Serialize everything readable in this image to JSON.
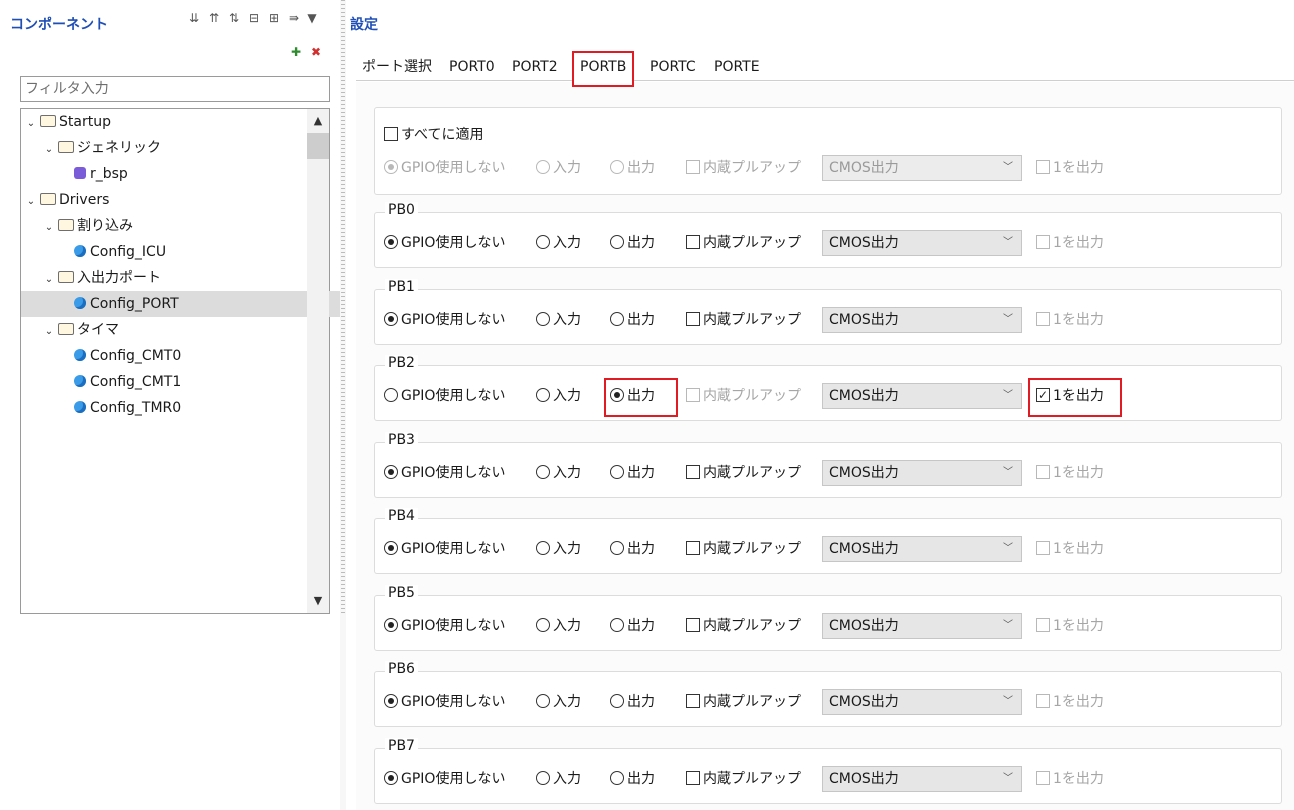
{
  "left": {
    "title": "コンポーネント",
    "filter_placeholder": "フィルタ入力",
    "tree": [
      {
        "label": "Startup",
        "level": 0,
        "kind": "folder"
      },
      {
        "label": "ジェネリック",
        "level": 1,
        "kind": "folder"
      },
      {
        "label": "r_bsp",
        "level": 2,
        "kind": "bsp"
      },
      {
        "label": "Drivers",
        "level": 0,
        "kind": "folder"
      },
      {
        "label": "割り込み",
        "level": 1,
        "kind": "folder"
      },
      {
        "label": "Config_ICU",
        "level": 2,
        "kind": "config"
      },
      {
        "label": "入出力ポート",
        "level": 1,
        "kind": "folder"
      },
      {
        "label": "Config_PORT",
        "level": 2,
        "kind": "config",
        "selected": true
      },
      {
        "label": "タイマ",
        "level": 1,
        "kind": "folder"
      },
      {
        "label": "Config_CMT0",
        "level": 2,
        "kind": "config"
      },
      {
        "label": "Config_CMT1",
        "level": 2,
        "kind": "config"
      },
      {
        "label": "Config_TMR0",
        "level": 2,
        "kind": "config"
      }
    ]
  },
  "right": {
    "title": "設定",
    "tabs": [
      "ポート選択",
      "PORT0",
      "PORT2",
      "PORTB",
      "PORTC",
      "PORTE"
    ],
    "active_tab": "PORTB",
    "apply_all_label": "すべてに適用",
    "labels": {
      "no_gpio": "GPIO使用しない",
      "input": "入力",
      "output": "出力",
      "pullup": "内蔵プルアップ",
      "mode": "CMOS出力",
      "out1": "1を出力"
    },
    "pins": [
      {
        "name": "PB0",
        "mode": "none",
        "out1": false
      },
      {
        "name": "PB1",
        "mode": "none",
        "out1": false
      },
      {
        "name": "PB2",
        "mode": "output",
        "out1": true
      },
      {
        "name": "PB3",
        "mode": "none",
        "out1": false
      },
      {
        "name": "PB4",
        "mode": "none",
        "out1": false
      },
      {
        "name": "PB5",
        "mode": "none",
        "out1": false
      },
      {
        "name": "PB6",
        "mode": "none",
        "out1": false
      },
      {
        "name": "PB7",
        "mode": "none",
        "out1": false
      }
    ]
  },
  "colors": {
    "accent": "#1f4fb5",
    "highlight": "#e01b24"
  }
}
